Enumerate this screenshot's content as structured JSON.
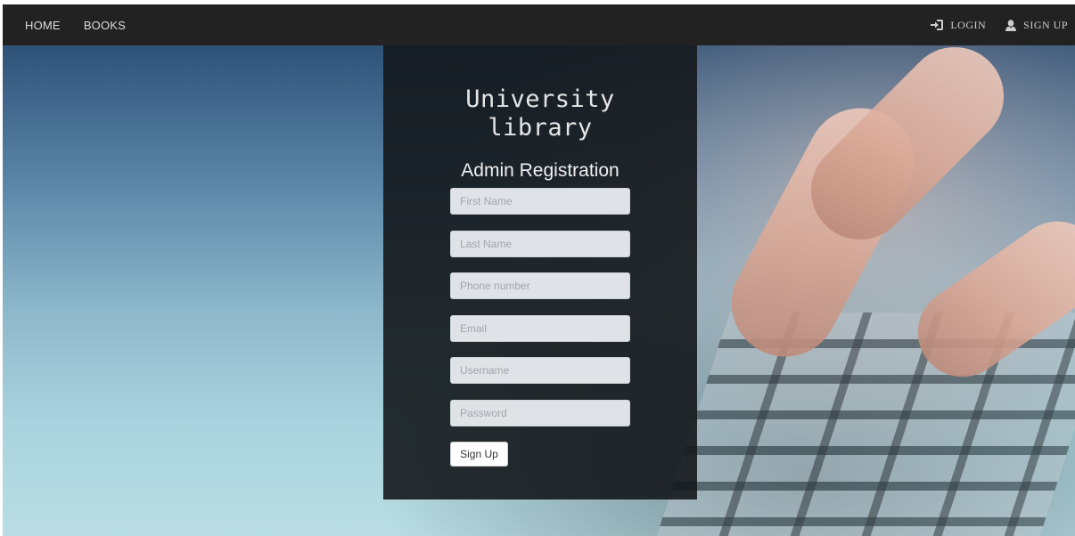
{
  "nav": {
    "left_links": [
      {
        "label": "HOME"
      },
      {
        "label": "BOOKS"
      }
    ],
    "login_label": "LOGIN",
    "signup_label": "SIGN UP"
  },
  "panel": {
    "brand_line1": "University",
    "brand_line2": "library",
    "subtitle": "Admin Registration",
    "fields": [
      {
        "placeholder": "First Name",
        "value": ""
      },
      {
        "placeholder": "Last Name",
        "value": ""
      },
      {
        "placeholder": "Phone number",
        "value": ""
      },
      {
        "placeholder": "Email",
        "value": ""
      },
      {
        "placeholder": "Username",
        "value": ""
      },
      {
        "placeholder": "Password",
        "value": ""
      }
    ],
    "submit_label": "Sign Up"
  },
  "icons": {
    "login": "log-in-icon",
    "signup": "user-icon"
  },
  "colors": {
    "navbar": "#222222",
    "panel": "#14181c",
    "field_bg": "#eef1f4"
  }
}
